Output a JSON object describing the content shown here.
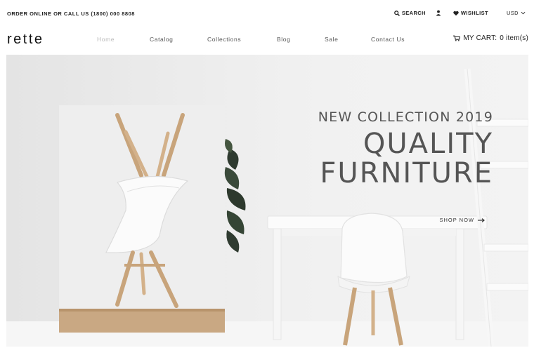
{
  "topbar": {
    "order_text": "ORDER ONLINE OR CALL US (1800) 000 8808",
    "search_label": "SEARCH",
    "wishlist_label": "WISHLIST",
    "currency": "USD"
  },
  "nav": {
    "logo": "rette",
    "items": [
      "Home",
      "Catalog",
      "Collections",
      "Blog",
      "Sale",
      "Contact Us"
    ],
    "cart_label": "MY CART:",
    "cart_count": "0 item(s)"
  },
  "hero": {
    "subtitle": "NEW COLLECTION 2019",
    "title_line1": "QUALITY",
    "title_line2": "FURNITURE",
    "cta": "SHOP NOW"
  },
  "icons": {
    "search": "search-icon",
    "user": "user-icon",
    "wishlist": "heart-icon",
    "currency": "chevron-down-icon",
    "cart": "cart-icon",
    "cta": "arrow-right-icon"
  }
}
